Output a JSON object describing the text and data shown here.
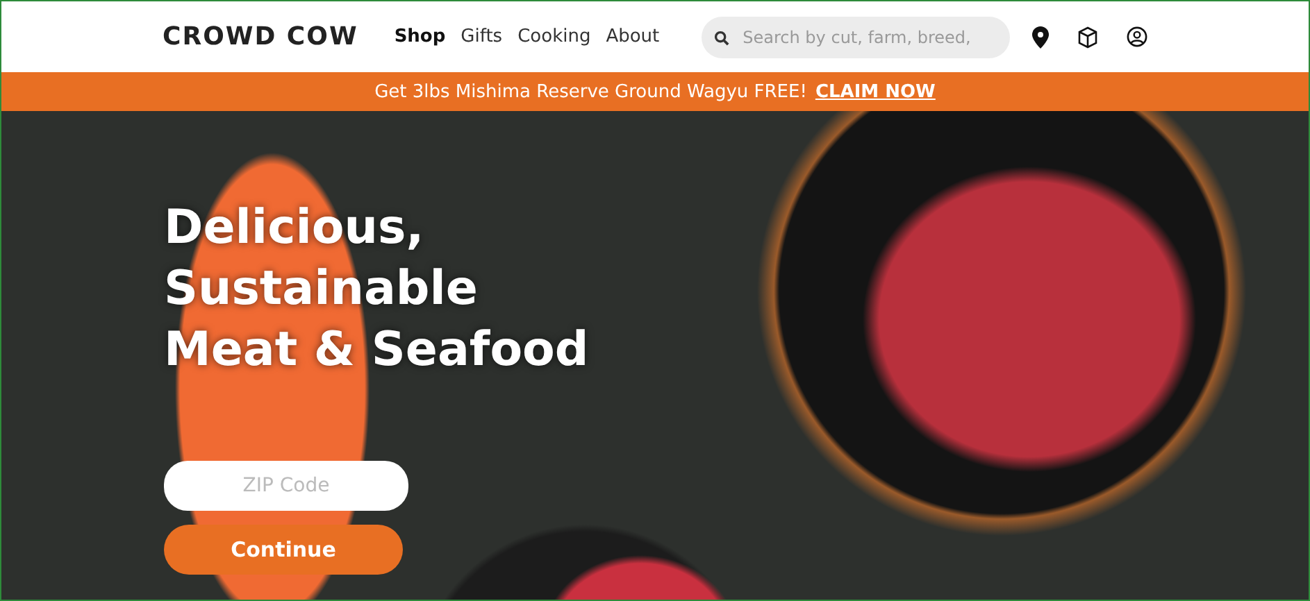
{
  "header": {
    "logo": "CROWD COW",
    "nav": [
      {
        "label": "Shop",
        "selected": true
      },
      {
        "label": "Gifts",
        "selected": false
      },
      {
        "label": "Cooking",
        "selected": false
      },
      {
        "label": "About",
        "selected": false
      }
    ],
    "search": {
      "placeholder": "Search by cut, farm, breed,"
    }
  },
  "banner": {
    "text": "Get 3lbs Mishima Reserve Ground Wagyu FREE!",
    "link": "CLAIM NOW"
  },
  "hero": {
    "headline": [
      "Delicious,",
      "Sustainable",
      "Meat & Seafood"
    ],
    "zip": {
      "placeholder": "ZIP Code"
    },
    "button": "Continue"
  }
}
